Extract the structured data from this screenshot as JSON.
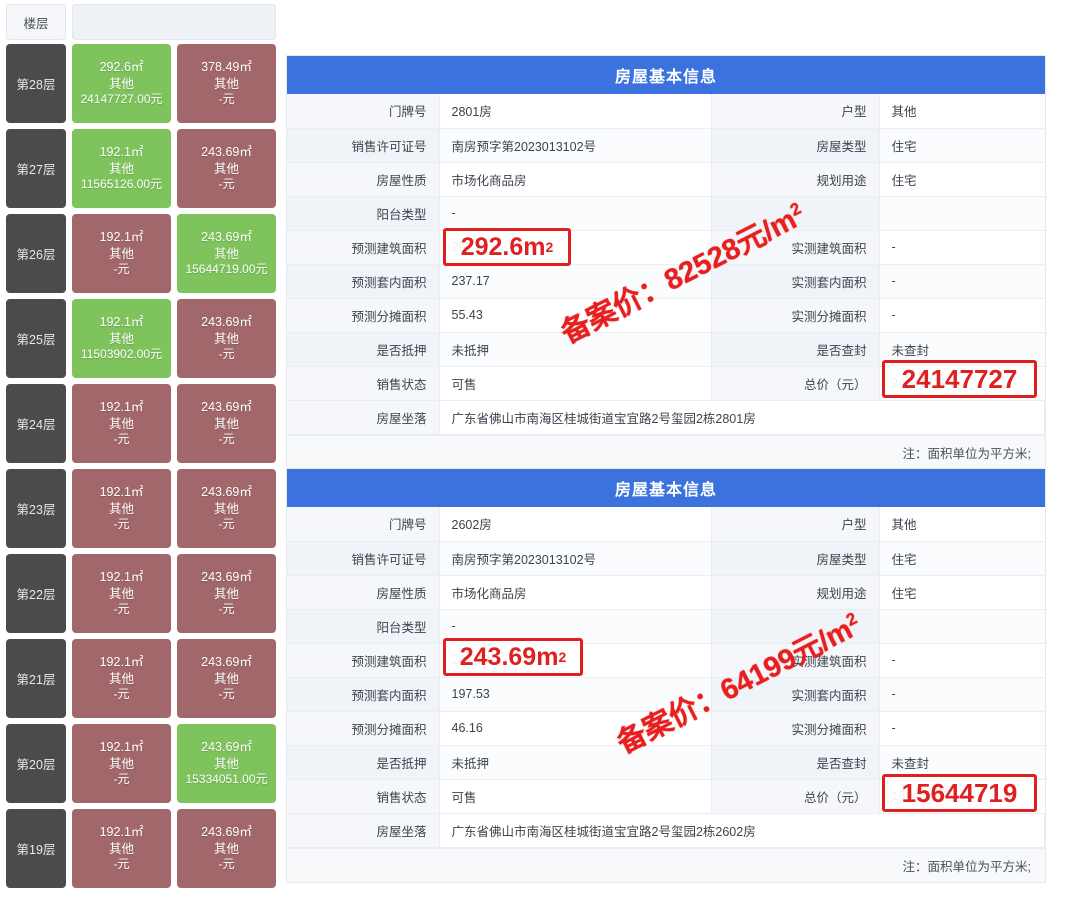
{
  "floor_panel": {
    "header": {
      "floor_label": "楼层",
      "blank_label": ""
    },
    "rows": [
      {
        "floor": "第28层",
        "units": [
          {
            "area": "292.6㎡",
            "type": "其他",
            "price": "24147727.00元",
            "state": "sold"
          },
          {
            "area": "378.49㎡",
            "type": "其他",
            "price": "-元",
            "state": "unsold"
          }
        ]
      },
      {
        "floor": "第27层",
        "units": [
          {
            "area": "192.1㎡",
            "type": "其他",
            "price": "11565126.00元",
            "state": "sold"
          },
          {
            "area": "243.69㎡",
            "type": "其他",
            "price": "-元",
            "state": "unsold"
          }
        ]
      },
      {
        "floor": "第26层",
        "units": [
          {
            "area": "192.1㎡",
            "type": "其他",
            "price": "-元",
            "state": "unsold"
          },
          {
            "area": "243.69㎡",
            "type": "其他",
            "price": "15644719.00元",
            "state": "sold"
          }
        ]
      },
      {
        "floor": "第25层",
        "units": [
          {
            "area": "192.1㎡",
            "type": "其他",
            "price": "11503902.00元",
            "state": "sold"
          },
          {
            "area": "243.69㎡",
            "type": "其他",
            "price": "-元",
            "state": "unsold"
          }
        ]
      },
      {
        "floor": "第24层",
        "units": [
          {
            "area": "192.1㎡",
            "type": "其他",
            "price": "-元",
            "state": "unsold"
          },
          {
            "area": "243.69㎡",
            "type": "其他",
            "price": "-元",
            "state": "unsold"
          }
        ]
      },
      {
        "floor": "第23层",
        "units": [
          {
            "area": "192.1㎡",
            "type": "其他",
            "price": "-元",
            "state": "unsold"
          },
          {
            "area": "243.69㎡",
            "type": "其他",
            "price": "-元",
            "state": "unsold"
          }
        ]
      },
      {
        "floor": "第22层",
        "units": [
          {
            "area": "192.1㎡",
            "type": "其他",
            "price": "-元",
            "state": "unsold"
          },
          {
            "area": "243.69㎡",
            "type": "其他",
            "price": "-元",
            "state": "unsold"
          }
        ]
      },
      {
        "floor": "第21层",
        "units": [
          {
            "area": "192.1㎡",
            "type": "其他",
            "price": "-元",
            "state": "unsold"
          },
          {
            "area": "243.69㎡",
            "type": "其他",
            "price": "-元",
            "state": "unsold"
          }
        ]
      },
      {
        "floor": "第20层",
        "units": [
          {
            "area": "192.1㎡",
            "type": "其他",
            "price": "-元",
            "state": "unsold"
          },
          {
            "area": "243.69㎡",
            "type": "其他",
            "price": "15334051.00元",
            "state": "sold"
          }
        ]
      },
      {
        "floor": "第19层",
        "units": [
          {
            "area": "192.1㎡",
            "type": "其他",
            "price": "-元",
            "state": "unsold"
          },
          {
            "area": "243.69㎡",
            "type": "其他",
            "price": "-元",
            "state": "unsold"
          }
        ]
      }
    ]
  },
  "colors": {
    "sold": "#7ec35c",
    "unsold": "#a2676a",
    "floor": "#4b4b4b",
    "header_blue": "#3b72de",
    "highlight_red": "#e02020"
  },
  "cards": [
    {
      "title": "房屋基本信息",
      "rows": [
        {
          "l1": "门牌号",
          "v1": "2801房",
          "l2": "户型",
          "v2": "其他"
        },
        {
          "l1": "销售许可证号",
          "v1": "南房预字第2023013102号",
          "l2": "房屋类型",
          "v2": "住宅"
        },
        {
          "l1": "房屋性质",
          "v1": "市场化商品房",
          "l2": "规划用途",
          "v2": "住宅"
        },
        {
          "l1": "阳台类型",
          "v1": "-",
          "l2": "",
          "v2": ""
        },
        {
          "l1": "预测建筑面积",
          "v1": "292.6",
          "l2": "实测建筑面积",
          "v2": "-"
        },
        {
          "l1": "预测套内面积",
          "v1": "237.17",
          "l2": "实测套内面积",
          "v2": "-"
        },
        {
          "l1": "预测分摊面积",
          "v1": "55.43",
          "l2": "实测分摊面积",
          "v2": "-"
        },
        {
          "l1": "是否抵押",
          "v1": "未抵押",
          "l2": "是否查封",
          "v2": "未查封"
        },
        {
          "l1": "销售状态",
          "v1": "可售",
          "l2": "总价（元）",
          "v2": "24147727"
        }
      ],
      "address_label": "房屋坐落",
      "address_value": "广东省佛山市南海区桂城街道宝宜路2号玺园2栋2801房",
      "note": "注：面积单位为平方米;",
      "highlight_area": "292.6m",
      "highlight_area_sup": "2",
      "highlight_price": "24147727",
      "annotation": "备案价：82528元/m",
      "annotation_sup": "2"
    },
    {
      "title": "房屋基本信息",
      "rows": [
        {
          "l1": "门牌号",
          "v1": "2602房",
          "l2": "户型",
          "v2": "其他"
        },
        {
          "l1": "销售许可证号",
          "v1": "南房预字第2023013102号",
          "l2": "房屋类型",
          "v2": "住宅"
        },
        {
          "l1": "房屋性质",
          "v1": "市场化商品房",
          "l2": "规划用途",
          "v2": "住宅"
        },
        {
          "l1": "阳台类型",
          "v1": "-",
          "l2": "",
          "v2": ""
        },
        {
          "l1": "预测建筑面积",
          "v1": "243.69",
          "l2": "实测建筑面积",
          "v2": "-"
        },
        {
          "l1": "预测套内面积",
          "v1": "197.53",
          "l2": "实测套内面积",
          "v2": "-"
        },
        {
          "l1": "预测分摊面积",
          "v1": "46.16",
          "l2": "实测分摊面积",
          "v2": "-"
        },
        {
          "l1": "是否抵押",
          "v1": "未抵押",
          "l2": "是否查封",
          "v2": "未查封"
        },
        {
          "l1": "销售状态",
          "v1": "可售",
          "l2": "总价（元）",
          "v2": "15644719"
        }
      ],
      "address_label": "房屋坐落",
      "address_value": "广东省佛山市南海区桂城街道宝宜路2号玺园2栋2602房",
      "note": "注：面积单位为平方米;",
      "highlight_area": "243.69m",
      "highlight_area_sup": "2",
      "highlight_price": "15644719",
      "annotation": "备案价：64199元/m",
      "annotation_sup": "2"
    }
  ]
}
